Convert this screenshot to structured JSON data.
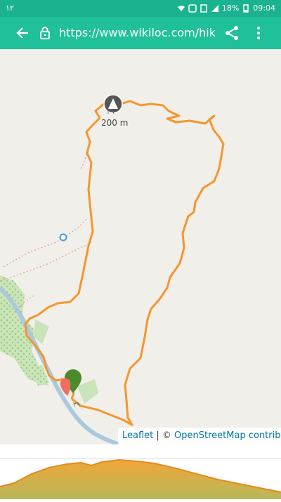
{
  "statusbar": {
    "left_text": "۱۲",
    "battery": "18%",
    "time": "09:04"
  },
  "toolbar": {
    "url": "https://www.wikiloc.com/hikin",
    "back_icon": "back-arrow-icon",
    "lock_icon": "lock-icon",
    "share_icon": "share-icon",
    "menu_icon": "more-vert-icon"
  },
  "map": {
    "peak_label": "200 m",
    "peak_label_prefix": "۲۹",
    "start_label": "۲۹",
    "attribution_leaflet": "Leaflet",
    "attribution_separator": " | © ",
    "attribution_osm": "OpenStreetMap contrib",
    "track_color": "#f5962f",
    "start_marker_color": "#4c8a2a",
    "end_marker_color": "#f06e5e"
  },
  "elevation": {
    "fill_top_color": "#f0a63a",
    "fill_bottom_color": "#b8b858"
  }
}
